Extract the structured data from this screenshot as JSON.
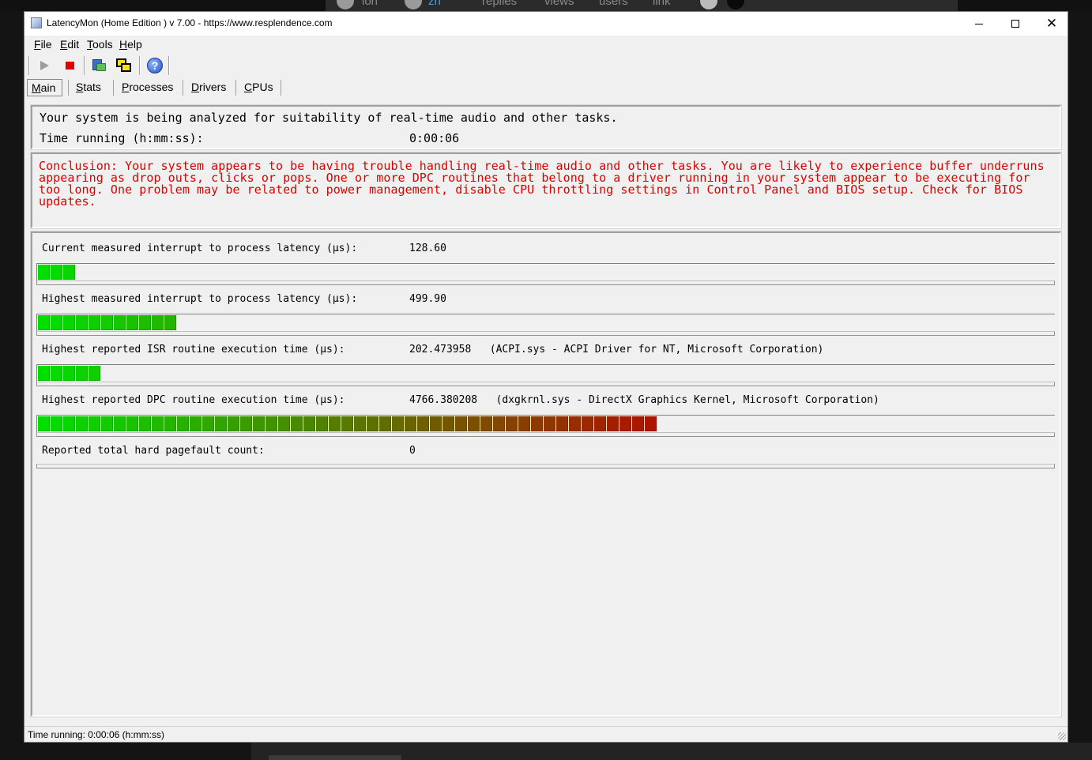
{
  "background": {
    "tab_texts": [
      "ion",
      "zh",
      "replies",
      "views",
      "users",
      "link"
    ]
  },
  "window": {
    "title": "LatencyMon  (Home Edition )  v 7.00 - https://www.resplendence.com",
    "controls": {
      "minimize": "minimize-icon",
      "maximize": "maximize-icon",
      "close": "close-icon"
    }
  },
  "menu": {
    "items": [
      "File",
      "Edit",
      "Tools",
      "Help"
    ]
  },
  "toolbar": {
    "icons": [
      "play-icon",
      "stop-icon",
      "analyze-icon",
      "windows-icon",
      "help-icon"
    ],
    "help_glyph": "?"
  },
  "tabs": [
    "Main",
    "Stats",
    "Processes",
    "Drivers",
    "CPUs"
  ],
  "status": {
    "message": "Your system is being analyzed for suitability of real-time audio and other tasks.",
    "time_label": "Time running (h:mm:ss):",
    "time_value": "0:00:06"
  },
  "conclusion": "Conclusion: Your system appears to be having trouble handling real-time audio and other tasks. You are likely to experience buffer underruns appearing as drop outs, clicks or pops. One or more DPC routines that belong to a driver running in your system appear to be executing for too long. One problem may be related to power management, disable CPU throttling settings in Control Panel and BIOS setup. Check for BIOS updates.",
  "metrics": [
    {
      "label": "Current measured interrupt to process latency (µs):",
      "value": "128.60",
      "level": 0.036
    },
    {
      "label": "Highest measured interrupt to process latency (µs):",
      "value": "499.90",
      "level": 0.136
    },
    {
      "label": "Highest reported ISR routine execution time (µs):",
      "value": "202.473958   (ACPI.sys - ACPI Driver for NT, Microsoft Corporation)",
      "level": 0.061
    },
    {
      "label": "Highest reported DPC routine execution time (µs):",
      "value": "4766.380208   (dxgkrnl.sys - DirectX Graphics Kernel, Microsoft Corporation)",
      "level": 0.608
    },
    {
      "label": "Reported total hard pagefault count:",
      "value": "0",
      "level": 0
    }
  ],
  "statusbar": {
    "text": "Time running: 0:00:06  (h:mm:ss)"
  },
  "colors": {
    "meter_green": "#00e000",
    "meter_red": "#b01000",
    "conclusion_red": "#e00000"
  }
}
